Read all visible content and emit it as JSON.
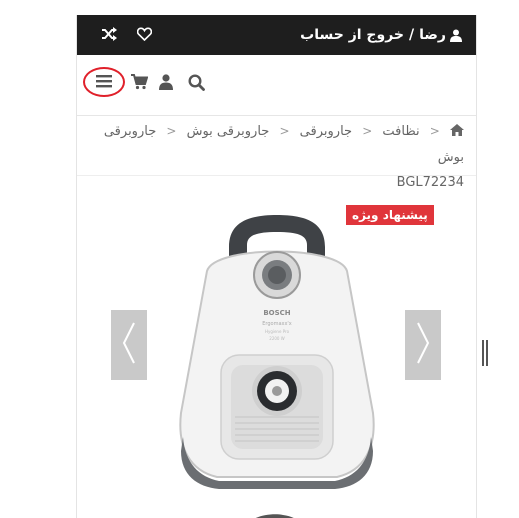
{
  "topbar": {
    "username": "رضا",
    "separator": "/",
    "logout_label": "خروج از حساب",
    "icons": [
      "shuffle-icon",
      "heart-icon",
      "user-icon"
    ]
  },
  "navbar": {
    "icons": [
      "menu-icon",
      "cart-icon",
      "user-icon",
      "search-icon"
    ]
  },
  "breadcrumb": {
    "items": [
      "نظافت",
      "جاروبرقی",
      "جاروبرقی بوش",
      "جاروبرقی بوش"
    ],
    "current": "BGL72234"
  },
  "product": {
    "badge": "پیشنهاد ویژه",
    "image_brand": "BOSCH",
    "image_model": "Ergomaxx'x",
    "image_detail": "Hygiene Pro",
    "image_sub": "2200 W"
  },
  "colors": {
    "topbar_bg": "#1e1e1e",
    "badge_bg": "#e0353b",
    "menu_highlight": "#e0202a",
    "arrow_bg": "#c9c9c9"
  }
}
